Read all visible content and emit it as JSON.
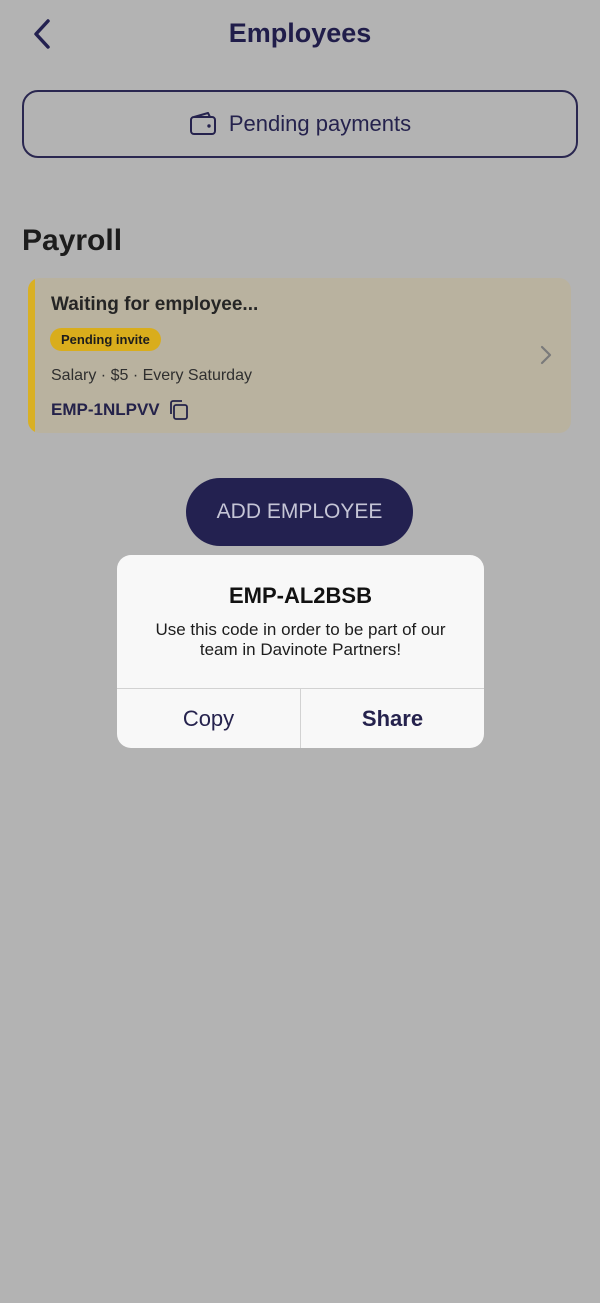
{
  "header": {
    "title": "Employees",
    "back_icon": "chevron-left-icon"
  },
  "pending_payments": {
    "label": "Pending payments",
    "icon": "wallet-icon"
  },
  "section": {
    "title": "Payroll"
  },
  "employee_card": {
    "title": "Waiting for employee...",
    "badge": "Pending invite",
    "info": "Salary · $5 · Every Saturday",
    "code": "EMP-1NLPVV",
    "copy_icon": "copy-icon",
    "accent_color": "#d9b024"
  },
  "add_button": {
    "label": "ADD EMPLOYEE"
  },
  "dialog": {
    "title": "EMP-AL2BSB",
    "message": "Use this code in order to be part of our team in Davinote Partners!",
    "copy_label": "Copy",
    "share_label": "Share"
  },
  "colors": {
    "brand": "#232150",
    "overlay": "#b3b3b3",
    "badge": "#d9ad1c"
  }
}
